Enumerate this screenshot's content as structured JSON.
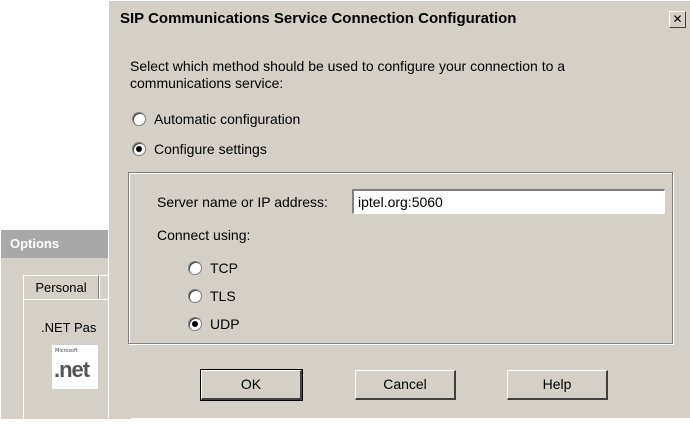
{
  "background_window": {
    "title": "Options",
    "tab_label": "Personal",
    "text": ".NET Pas",
    "logo_small": "Microsoft",
    "logo_text": ".net"
  },
  "dialog": {
    "title": "SIP Communications Service Connection Configuration",
    "close_symbol": "✕",
    "description": "Select which method should be used to configure your connection to a communications service:",
    "methods": [
      {
        "label": "Automatic configuration",
        "checked": false
      },
      {
        "label": "Configure settings",
        "checked": true
      }
    ],
    "server": {
      "label": "Server name or IP address:",
      "value": "iptel.org:5060"
    },
    "connect_using": {
      "label": "Connect using:",
      "options": [
        {
          "label": "TCP",
          "checked": false
        },
        {
          "label": "TLS",
          "checked": false
        },
        {
          "label": "UDP",
          "checked": true
        }
      ]
    },
    "buttons": {
      "ok": "OK",
      "cancel": "Cancel",
      "help": "Help"
    }
  }
}
